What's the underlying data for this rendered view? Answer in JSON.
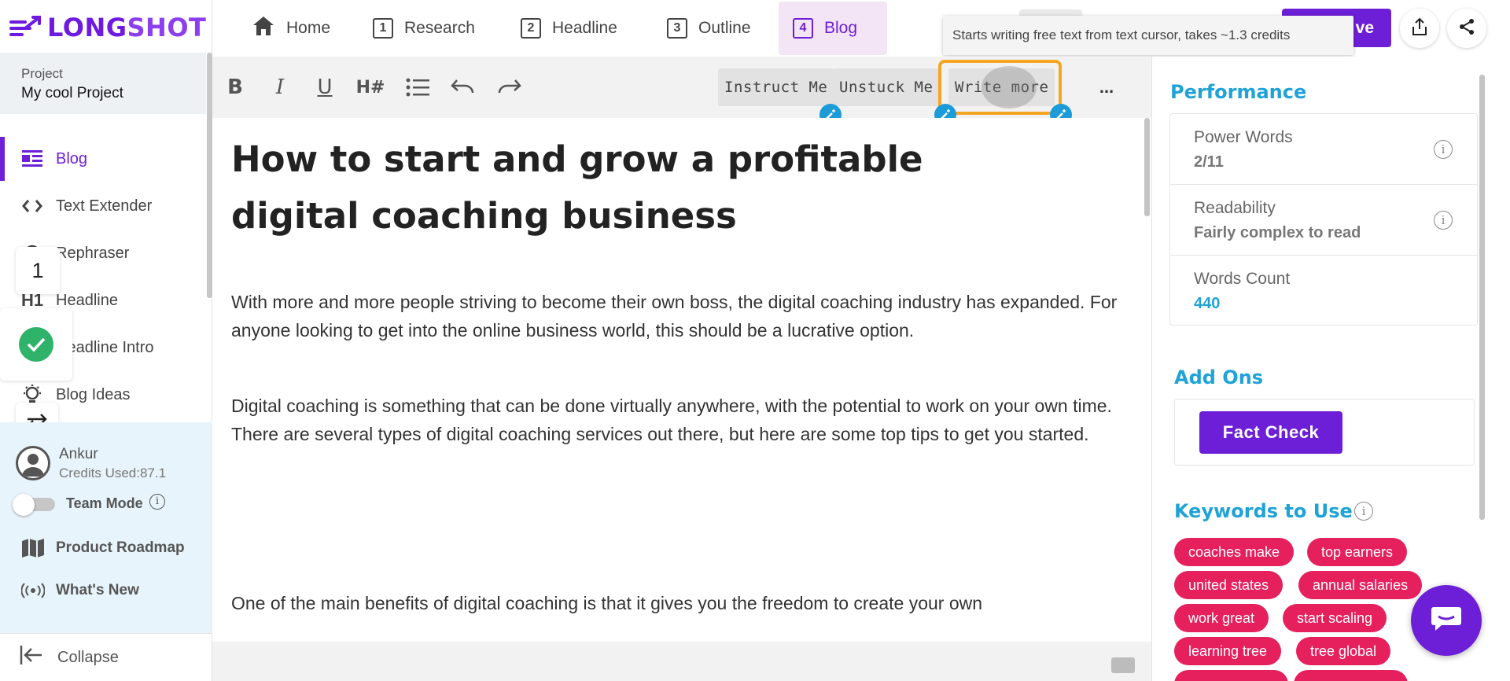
{
  "app": {
    "logo_text_a": "LONG",
    "logo_text_b": "SHOT"
  },
  "project": {
    "label": "Project",
    "name": "My cool Project"
  },
  "sidebar": {
    "items": [
      {
        "label": "Blog",
        "icon": "blog-icon"
      },
      {
        "label": "Text Extender",
        "icon": "code-brackets-icon"
      },
      {
        "label": "Rephraser",
        "icon": "rephrase-icon"
      },
      {
        "label": "Headline",
        "icon": "h1-icon"
      },
      {
        "label": "Headline Intro",
        "icon": "headline-intro-icon"
      },
      {
        "label": "Blog Ideas",
        "icon": "lightbulb-icon"
      }
    ],
    "floating_badge": "1",
    "user": {
      "name": "Ankur",
      "credits": "Credits Used:87.1"
    },
    "team_mode_label": "Team Mode",
    "links": [
      {
        "label": "Product Roadmap",
        "icon": "map-icon"
      },
      {
        "label": "What's New",
        "icon": "broadcast-icon"
      }
    ],
    "collapse_label": "Collapse"
  },
  "topbar": {
    "tabs": [
      {
        "label": "Home",
        "num": ""
      },
      {
        "label": "Research",
        "num": "1"
      },
      {
        "label": "Headline",
        "num": "2"
      },
      {
        "label": "Outline",
        "num": "3"
      },
      {
        "label": "Blog",
        "num": "4"
      }
    ],
    "save_label": "ve",
    "tooltip": "Starts writing free text from text cursor, takes ~1.3 credits"
  },
  "toolbar": {
    "buttons": [
      "Instruct Me",
      "Unstuck Me",
      "Write more"
    ],
    "more": "..."
  },
  "editor": {
    "title": "How to start and grow a profitable digital coaching business",
    "paragraphs": [
      "With more and more people striving to become their own boss, the digital coaching industry has expanded. For anyone looking to get into the online business world, this should be a lucrative option.",
      "Digital coaching is something that can be done virtually anywhere, with the potential to work on your own time. There are several types of digital coaching services out there, but here are some top tips to get you started.",
      "One of the main benefits of digital coaching is that it gives you the freedom to create your own"
    ]
  },
  "panel": {
    "performance_title": "Performance",
    "metrics": [
      {
        "label": "Power Words",
        "value": "2/11"
      },
      {
        "label": "Readability",
        "value": "Fairly complex to read"
      },
      {
        "label": "Words Count",
        "value": "440"
      }
    ],
    "addons_title": "Add Ons",
    "fact_check": "Fact Check",
    "keywords_title": "Keywords to Use",
    "keywords": [
      "coaches make",
      "top earners",
      "united states",
      "annual salaries",
      "work great",
      "start scaling",
      "learning tree",
      "tree global"
    ]
  },
  "colors": {
    "brand": "#6c1fd6",
    "accent": "#1fa3d6",
    "keyword": "#e61f5d",
    "highlight": "#f5a524"
  }
}
